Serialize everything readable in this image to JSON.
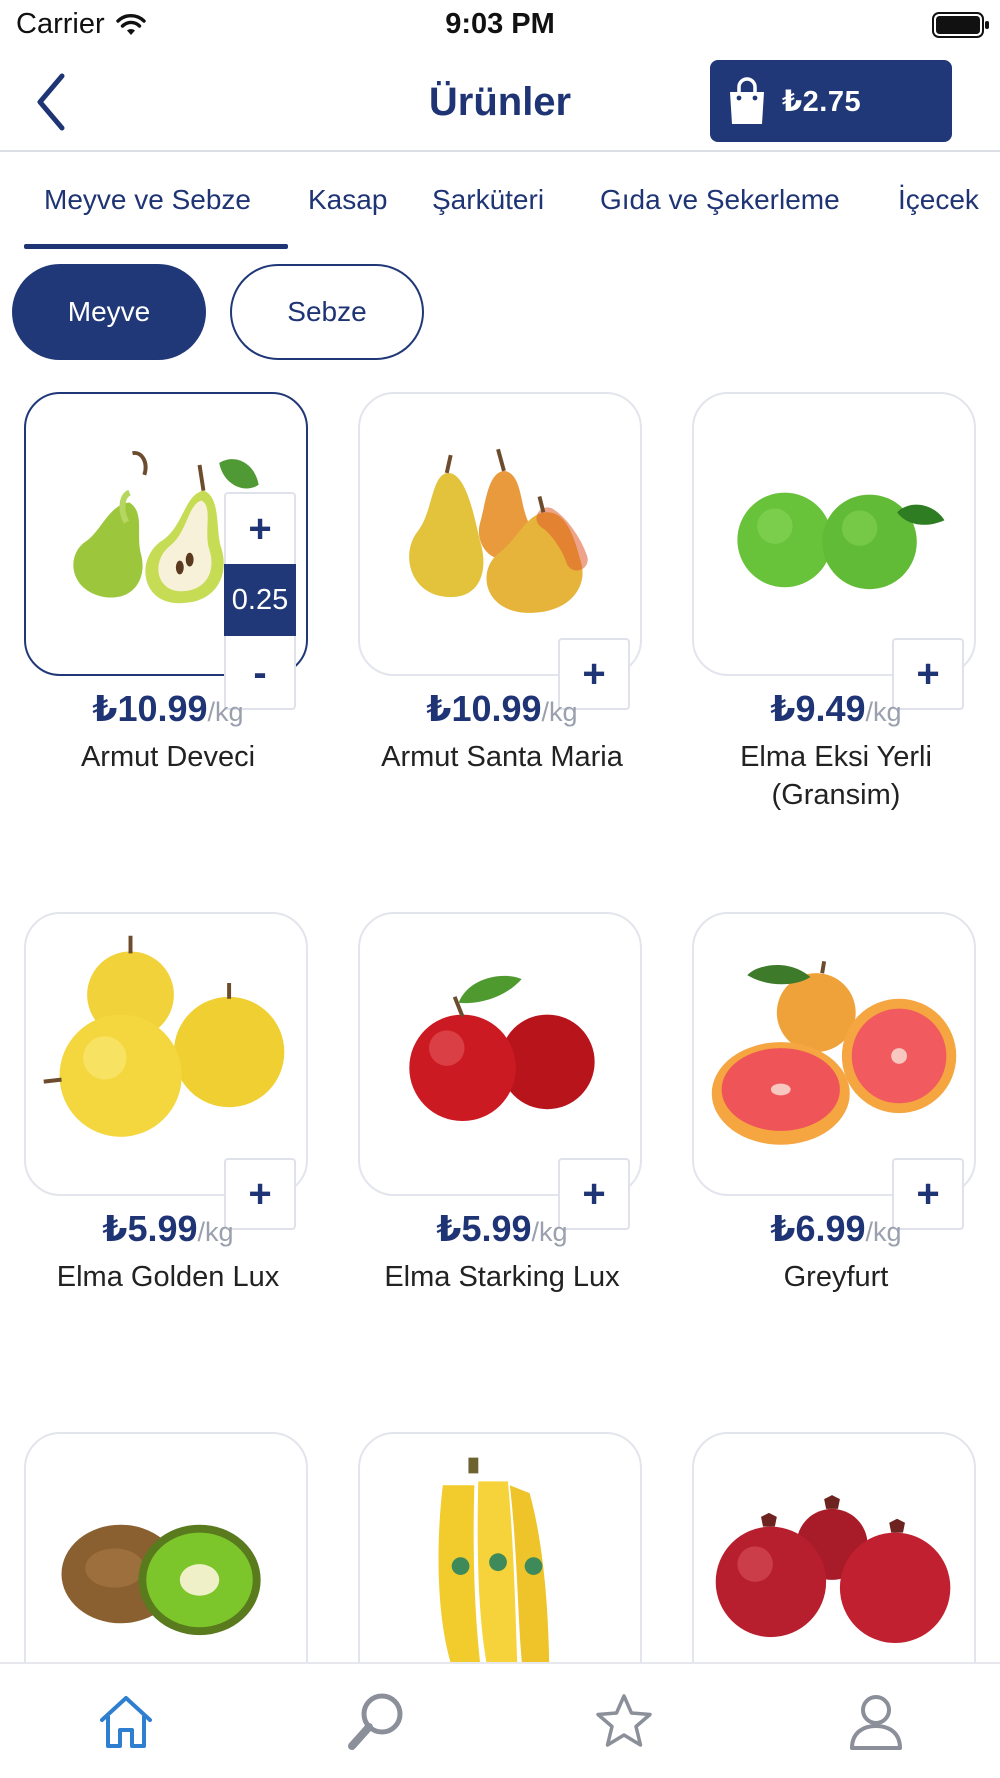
{
  "status_bar": {
    "carrier": "Carrier",
    "time": "9:03 PM"
  },
  "header": {
    "title": "Ürünler",
    "cart_total": "₺2.75"
  },
  "tabs": [
    {
      "label": "Meyve ve Sebze",
      "active": true
    },
    {
      "label": "Kasap"
    },
    {
      "label": "Şarküteri"
    },
    {
      "label": "Gıda ve Şekerleme"
    },
    {
      "label": "İçecek"
    }
  ],
  "subcategories": [
    {
      "label": "Meyve",
      "active": true
    },
    {
      "label": "Sebze"
    }
  ],
  "products": [
    {
      "name": "Armut Deveci",
      "price": "₺10.99",
      "unit": "/kg",
      "quantity": "0.25",
      "image": "pear-halved"
    },
    {
      "name": "Armut Santa Maria",
      "price": "₺10.99",
      "unit": "/kg",
      "image": "pears-yellow"
    },
    {
      "name": "Elma  Eksi Yerli (Gransim)",
      "price": "₺9.49",
      "unit": "/kg",
      "image": "green-apples"
    },
    {
      "name": "Elma Golden Lux",
      "price": "₺5.99",
      "unit": "/kg",
      "image": "golden-apples"
    },
    {
      "name": "Elma Starking Lux",
      "price": "₺5.99",
      "unit": "/kg",
      "image": "red-apples"
    },
    {
      "name": "Greyfurt",
      "price": "₺6.99",
      "unit": "/kg",
      "image": "grapefruit"
    },
    {
      "name": "",
      "price": "",
      "unit": "",
      "image": "kiwi"
    },
    {
      "name": "",
      "price": "",
      "unit": "",
      "image": "bananas"
    },
    {
      "name": "",
      "price": "",
      "unit": "",
      "image": "pomegranates"
    }
  ],
  "controls": {
    "add": "+",
    "minus": "-"
  },
  "bottom_nav": [
    {
      "icon": "home-icon",
      "active": true
    },
    {
      "icon": "search-icon"
    },
    {
      "icon": "star-icon"
    },
    {
      "icon": "profile-icon"
    }
  ],
  "colors": {
    "brand": "#213878",
    "inactive_nav": "#8a8f99",
    "active_nav": "#2f7fd1",
    "unit_gray": "#9aa0ad"
  }
}
